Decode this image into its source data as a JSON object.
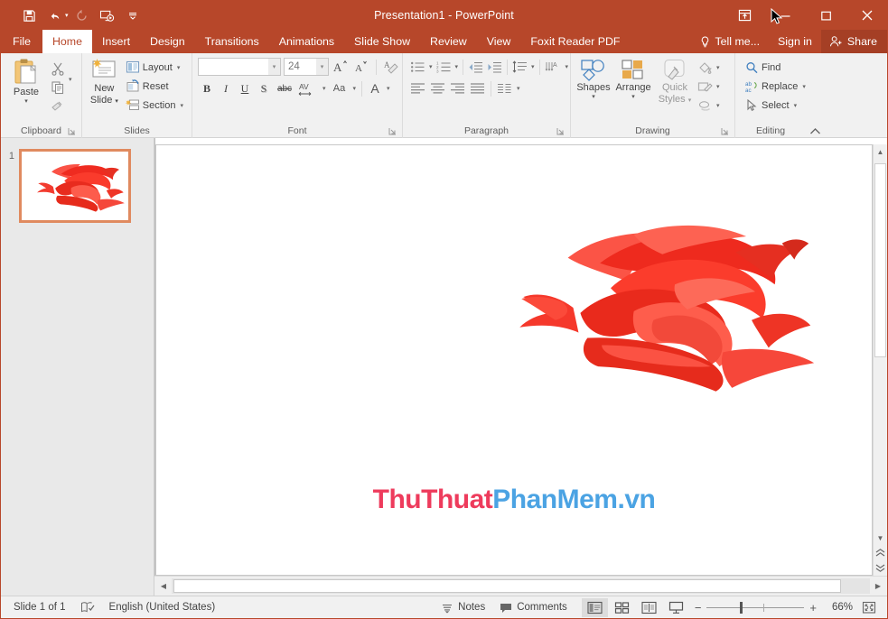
{
  "window": {
    "title": "Presentation1 - PowerPoint",
    "quick_access": [
      {
        "name": "save",
        "label": "Save"
      },
      {
        "name": "undo",
        "label": "Undo"
      },
      {
        "name": "redo",
        "label": "Redo"
      },
      {
        "name": "start-from-beginning",
        "label": "Start From Beginning"
      },
      {
        "name": "customize-qat",
        "label": "Customize Quick Access Toolbar"
      }
    ],
    "controls": {
      "ribbon_display_options": "Ribbon Display Options",
      "minimize": "Minimize",
      "maximize": "Maximize",
      "close": "Close"
    },
    "accent_color": "#b7472a",
    "share_bg": "#a53f25"
  },
  "tabs": [
    {
      "label": "File",
      "active": false
    },
    {
      "label": "Home",
      "active": true
    },
    {
      "label": "Insert",
      "active": false
    },
    {
      "label": "Design",
      "active": false
    },
    {
      "label": "Transitions",
      "active": false
    },
    {
      "label": "Animations",
      "active": false
    },
    {
      "label": "Slide Show",
      "active": false
    },
    {
      "label": "Review",
      "active": false
    },
    {
      "label": "View",
      "active": false
    },
    {
      "label": "Foxit Reader PDF",
      "active": false
    }
  ],
  "tab_right": {
    "tell_me": "Tell me...",
    "sign_in": "Sign in",
    "share": "Share"
  },
  "ribbon": {
    "collapse_label": "Collapse the Ribbon",
    "groups": {
      "clipboard": {
        "label": "Clipboard",
        "paste": "Paste",
        "cut": "Cut",
        "copy": "Copy",
        "format_painter": "Format Painter"
      },
      "slides": {
        "label": "Slides",
        "new_slide_line1": "New",
        "new_slide_line2": "Slide",
        "layout": "Layout",
        "reset": "Reset",
        "section": "Section"
      },
      "font": {
        "label": "Font",
        "font_name_value": "",
        "font_name_placeholder": "",
        "font_size_value": "24",
        "increase_font": "Increase Font Size",
        "decrease_font": "Decrease Font Size",
        "clear_formatting": "Clear All Formatting",
        "bold": "B",
        "italic": "I",
        "underline": "U",
        "shadow": "S",
        "strikethrough": "abc",
        "character_spacing": "AV",
        "change_case": "Aa",
        "font_color": "A"
      },
      "paragraph": {
        "label": "Paragraph",
        "bullets": "Bullets",
        "numbering": "Numbering",
        "decrease_indent": "Decrease List Level",
        "increase_indent": "Increase List Level",
        "line_spacing": "Line Spacing",
        "text_direction": "Text Direction",
        "align_text": "Align Text",
        "convert_smartart": "Convert to SmartArt",
        "align_left": "Align Left",
        "align_center": "Center",
        "align_right": "Align Right",
        "justify": "Justify",
        "columns": "Columns"
      },
      "drawing": {
        "label": "Drawing",
        "shapes": "Shapes",
        "arrange": "Arrange",
        "quick_styles_line1": "Quick",
        "quick_styles_line2": "Styles",
        "shape_fill": "Shape Fill",
        "shape_outline": "Shape Outline",
        "shape_effects": "Shape Effects"
      },
      "editing": {
        "label": "Editing",
        "find": "Find",
        "replace": "Replace",
        "select": "Select"
      }
    }
  },
  "thumbnails": [
    {
      "number": "1",
      "selected": true,
      "border_color": "#e08a5f"
    }
  ],
  "slide": {
    "watermark": {
      "part1": "ThuThuat",
      "part2": "PhanMem",
      "part3": ".vn",
      "color1": "#ee3b5c",
      "color2": "#4ba3e3"
    },
    "image_alt": "red-rose"
  },
  "status": {
    "slide_counter": "Slide 1 of 1",
    "language": "English (United States)",
    "notes": "Notes",
    "comments": "Comments",
    "views": [
      {
        "name": "normal-view",
        "label": "Normal",
        "selected": true
      },
      {
        "name": "slide-sorter-view",
        "label": "Slide Sorter",
        "selected": false
      },
      {
        "name": "reading-view",
        "label": "Reading View",
        "selected": false
      },
      {
        "name": "slide-show-view",
        "label": "Slide Show",
        "selected": false
      }
    ],
    "zoom_out": "−",
    "zoom_in": "+",
    "zoom_level": "66%",
    "fit_to_window": "Fit slide to current window"
  }
}
